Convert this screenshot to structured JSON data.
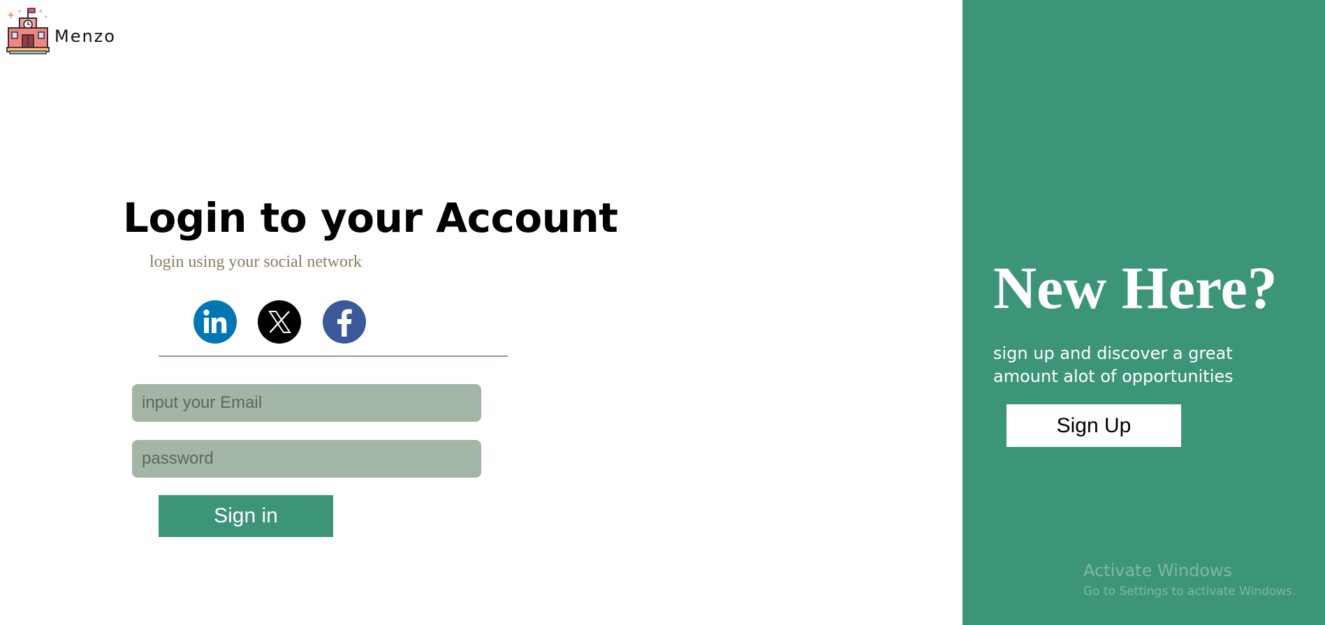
{
  "brand": {
    "name": "Menzo",
    "logo_icon": "school-building-icon"
  },
  "login": {
    "title": "Login to your Account",
    "subtitle": "login using your social network",
    "social": [
      {
        "name": "LinkedIn",
        "icon": "linkedin-icon",
        "color": "#0077b5"
      },
      {
        "name": "X",
        "icon": "x-icon",
        "color": "#000000"
      },
      {
        "name": "Facebook",
        "icon": "facebook-icon",
        "color": "#3b5998"
      }
    ],
    "email_placeholder": "input your Email",
    "password_placeholder": "password",
    "signin_label": "Sign in"
  },
  "panel": {
    "heading": "New Here?",
    "text": "sign up and discover a great amount alot of opportunities",
    "signup_label": "Sign Up"
  },
  "watermark": {
    "title": "Activate Windows",
    "subtitle": "Go to Settings to activate Windows."
  },
  "colors": {
    "accent": "#3d9579",
    "input_bg": "#a3b5a5",
    "subtitle_text": "#8b7a62",
    "divider": "#9e9886"
  }
}
